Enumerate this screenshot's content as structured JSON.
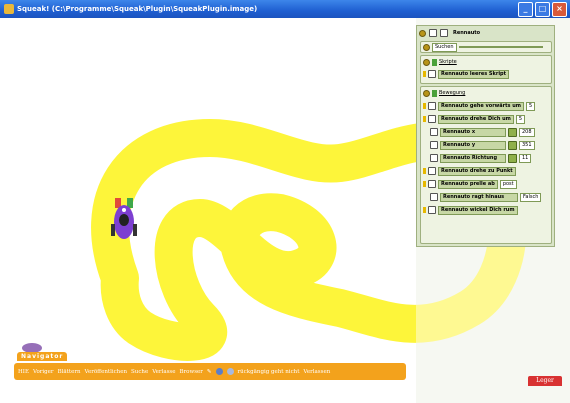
{
  "window": {
    "title": "Squeak! (C:\\Programme\\Squeak\\Plugin\\SqueakPlugin.image)",
    "buttons": [
      "_",
      "□",
      "×"
    ]
  },
  "viewer": {
    "object_name": "Rennauto",
    "search_label": "Suchen",
    "search_value": "",
    "scripts_category": "Skripte",
    "empty_script": "Rennauto leeres Skript",
    "motion_category": "Bewegung",
    "rows": [
      {
        "name": "Rennauto gehe vorwärts um",
        "value": "5"
      },
      {
        "name": "Rennauto drehe Dich um",
        "value": "5"
      },
      {
        "name": "Rennauto x",
        "value": "208"
      },
      {
        "name": "Rennauto y",
        "value": "351"
      },
      {
        "name": "Rennauto Richtung",
        "value": "11"
      },
      {
        "name": "Rennauto drehe zu Punkt",
        "value": ""
      },
      {
        "name": "Rennauto prelle ab",
        "value": "post"
      },
      {
        "name": "Rennauto ragt hinaus",
        "value": "Falsch"
      },
      {
        "name": "Rennauto wickel Dich rum",
        "value": ""
      }
    ]
  },
  "navigator": {
    "label": "Navigator",
    "items": [
      "HIE",
      "Voriger",
      "Blättern",
      "Veröffentlichen",
      "Suche",
      "Verlasse",
      "Browser",
      "rückgängig geht nicht",
      "Verlassen"
    ]
  },
  "trash_label": "Leger",
  "colors": {
    "track": "#fdf53a",
    "green_pane": "#eef3e7",
    "navigator": "#f3a21c",
    "car_body": "#7d3fd1"
  }
}
